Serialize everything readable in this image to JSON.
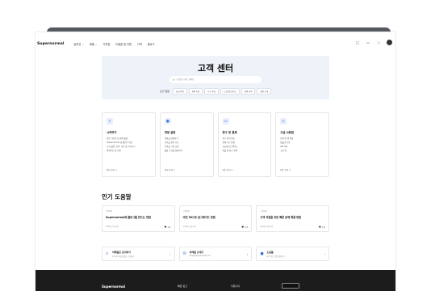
{
  "nav": {
    "brand": "Supernormal",
    "items": [
      "솔루션 ⌄",
      "제품 ⌄",
      "가격정",
      "도움말 및 지원",
      "가격",
      "블로그"
    ],
    "icons": [
      "globe-icon",
      "doc-icon",
      "search-icon"
    ]
  },
  "hero": {
    "title": "고객 센터",
    "search_placeholder": "무엇을 도와드릴까요",
    "popular_label": "인기 질문",
    "chips": [
      "요금 문의",
      "회의 녹음",
      "녹스 작성",
      "스크린샷 업로드",
      "회의 요약",
      "팀원 초대"
    ]
  },
  "categories": [
    {
      "icon": "plus-icon",
      "title": "시작하기",
      "items": [
        "처음 가입과 첫 회의 설정",
        "Supernormal 및 캘린더 연동",
        "시작 설정, 요약, 녹음 및 가져오기",
        "업데이트 및 지원"
      ],
      "more": "모두 보기 →"
    },
    {
      "icon": "user-icon",
      "title": "계정 설정",
      "items": [
        "계정을 변경하기",
        "조직을 정리 가능",
        "조직을 시간 조정",
        "설정 프로필 변경하기"
      ],
      "more": "모두 보기 →"
    },
    {
      "icon": "card-icon",
      "title": "청구 및 결제",
      "items": [
        "청구 내역 확인",
        "결제 수단 변경",
        "요금제 업그레이드",
        "환불 및 취소 정책"
      ],
      "more": "모두 보기 →"
    },
    {
      "icon": "headphone-icon",
      "title": "고급 사용법",
      "items": [
        "연결 및 앱 통합",
        "템플릿 사용",
        "API 사용",
        "고급 팁"
      ],
      "more": "모두 보기 →"
    }
  ],
  "popular_section": {
    "title": "인기 도움말",
    "articles": [
      {
        "category": "고객지원",
        "title": "Supernormal에 블로그를 만드는 방법",
        "date": "2024년 1월 2일",
        "likes": "124"
      },
      {
        "category": "고객지원",
        "title": "비전 30으로 업그레이드 방법",
        "date": "2024년 1월 2일",
        "likes": "124"
      },
      {
        "category": "고객지원",
        "title": "고객 지원을 위한 빠른 문제 해결 방법",
        "date": "2024년 1월 2일",
        "likes": "124"
      }
    ]
  },
  "contacts": [
    {
      "icon": "headset-icon",
      "title": "이메일로 문의하기",
      "sub": "24시간 이내 답변을 드립니다"
    },
    {
      "icon": "mail-icon",
      "title": "이메일 보내기",
      "sub": "help@supernormal.com"
    },
    {
      "icon": "info-icon",
      "title": "도움말",
      "sub": "자주 묻는 질문 확인하기"
    }
  ],
  "footer": {
    "brand": "Supernormal",
    "col1": "빠른 링크",
    "col2": "커뮤니티"
  }
}
